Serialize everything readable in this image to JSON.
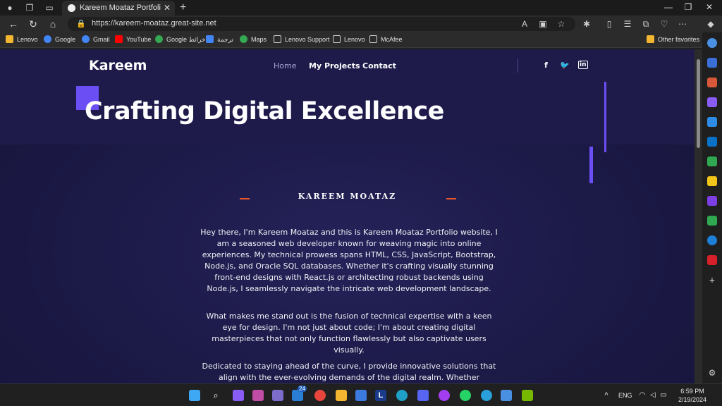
{
  "browser": {
    "tab_title": "Kareem Moataz Portfolio: Crafting",
    "url": "https://kareem-moataz.great-site.net",
    "favorites": [
      {
        "label": "Lenovo",
        "icon": "folder-icon",
        "color": "#f2b631"
      },
      {
        "label": "Google",
        "icon": "google-icon",
        "color": "#4285f4"
      },
      {
        "label": "Gmail",
        "icon": "google-icon",
        "color": "#4285f4"
      },
      {
        "label": "YouTube",
        "icon": "youtube-icon",
        "color": "#ff0000"
      },
      {
        "label": "Google خرائط",
        "icon": "maps-icon",
        "color": "#34a853"
      },
      {
        "label": "ترجمة",
        "icon": "translate-icon",
        "color": "#4285f4"
      },
      {
        "label": "Maps",
        "icon": "maps-icon",
        "color": "#34a853"
      },
      {
        "label": "Lenovo Support",
        "icon": "page-icon",
        "color": "#cfcfcf"
      },
      {
        "label": "Lenovo",
        "icon": "page-icon",
        "color": "#cfcfcf"
      },
      {
        "label": "McAfee",
        "icon": "page-icon",
        "color": "#cfcfcf"
      }
    ],
    "other_favorites": "Other favorites"
  },
  "site": {
    "brand": "Kareem",
    "nav": {
      "home": "Home",
      "projects": "My Projects",
      "contact": "Contact"
    },
    "social": {
      "facebook": "f",
      "twitter": "🐦",
      "linkedin": "in"
    },
    "headline": "Crafting Digital Excellence",
    "name": "KAREEM MOATAZ",
    "paragraphs": [
      "Hey there, I'm Kareem Moataz and this is Kareem Moataz Portfolio website, I am a seasoned web developer known for weaving magic into online experiences. My technical prowess spans HTML, CSS, JavaScript, Bootstrap, Node.js, and Oracle SQL databases. Whether it's crafting visually stunning front-end designs with React.js or architecting robust backends using Node.js, I seamlessly navigate the intricate web development landscape.",
      "What makes me stand out is the fusion of technical expertise with a keen eye for design. I'm not just about code; I'm about creating digital masterpieces that not only function flawlessly but also captivate users visually.",
      "Dedicated to staying ahead of the curve, I provide innovative solutions that align with the ever-evolving demands of the digital realm. Whether leveraging Bootstrap for responsive"
    ],
    "colors": {
      "accent": "#6c4ef5",
      "dash": "#e8562a",
      "background": "#1c1a47"
    }
  },
  "taskbar": {
    "language": "ENG",
    "time": "6:59 PM",
    "date": "2/19/2024",
    "badge": "24"
  }
}
